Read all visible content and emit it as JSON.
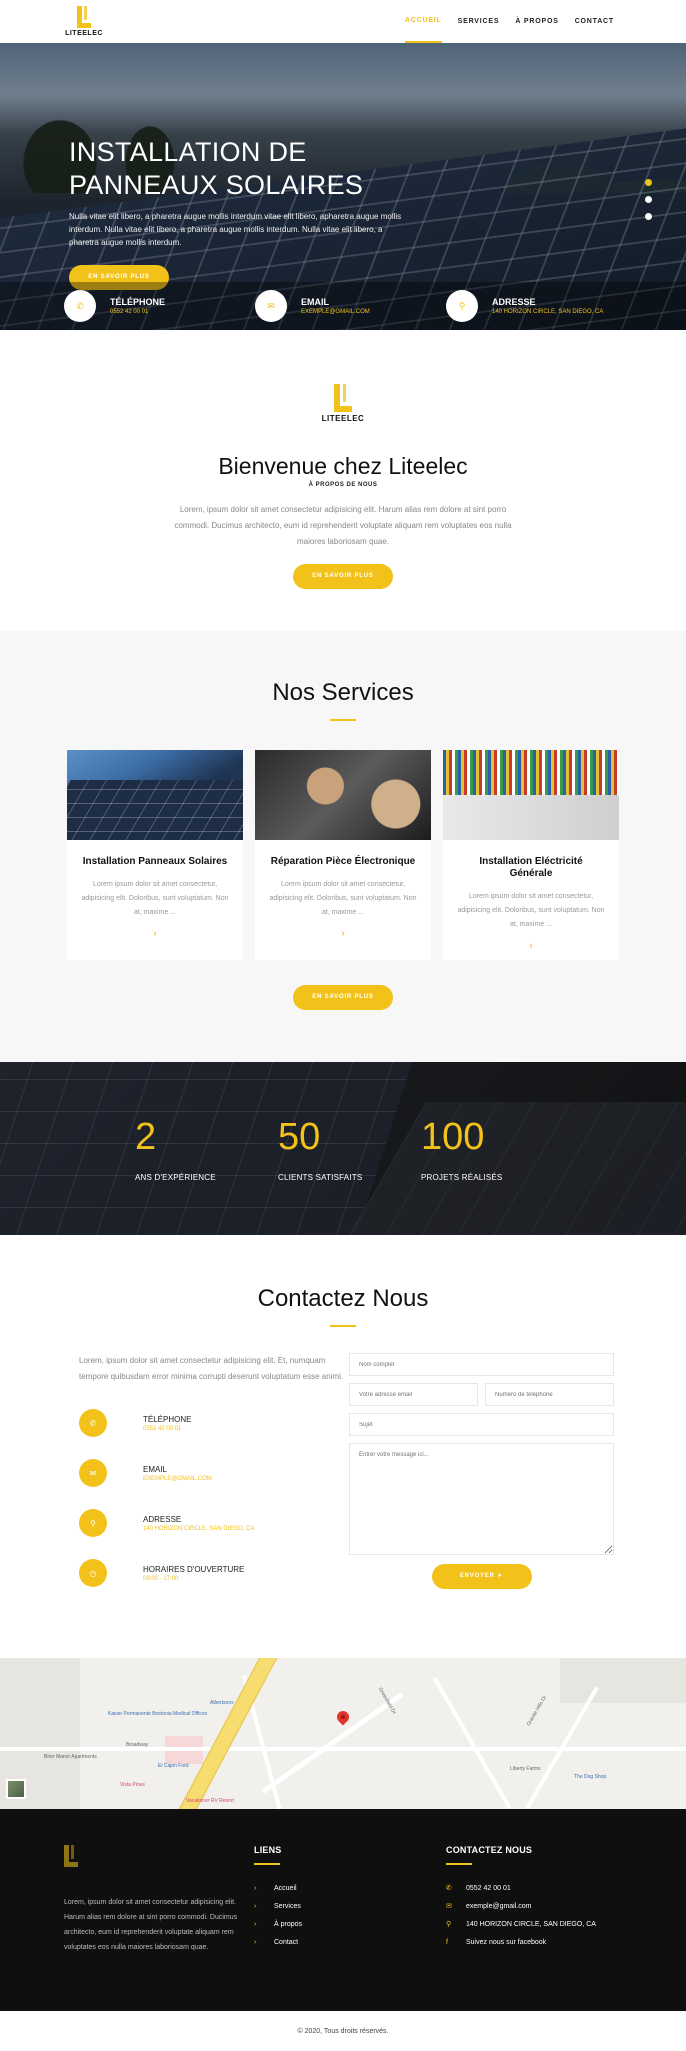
{
  "brand": {
    "name": "LITEELEC"
  },
  "nav": {
    "items": [
      {
        "label": "ACCUEIL",
        "active": true
      },
      {
        "label": "SERVICES"
      },
      {
        "label": "À PROPOS"
      },
      {
        "label": "CONTACT"
      }
    ]
  },
  "hero": {
    "title_line1": "INSTALLATION DE",
    "title_line2": "PANNEAUX SOLAIRES",
    "text": "Nulla vitae elit libero, a pharetra augue mollis interdum vitae elit libero, apharetra augue mollis interdum. Nulla vitae elit libero, a pharetra augue mollis interdum. Nulla vitae elit libero, a pharetra augue mollis interdum.",
    "button": "EN SAVOIR PLUS",
    "slides": 3,
    "active_slide": 1
  },
  "info_bar": [
    {
      "icon": "phone-icon",
      "label": "TÉLÉPHONE",
      "value": "0552 42 00 01"
    },
    {
      "icon": "email-icon",
      "label": "EMAIL",
      "value": "EXEMPLE@GMAIL.COM"
    },
    {
      "icon": "location-icon",
      "label": "ADRESSE",
      "value": "140 HORIZON CIRCLE, SAN DIEGO, CA"
    }
  ],
  "about": {
    "logo": "LITEELEC",
    "title": "Bienvenue chez Liteelec",
    "subtitle": "À PROPOS DE NOUS",
    "text": "Lorem, ipsum dolor sit amet consectetur adipisicing elit. Harum alias rem dolore at sint porro commodi. Ducimus architecto, eum id reprehenderit voluptate aliquam rem voluptates eos nulla maiores laboriosam quae.",
    "button": "EN SAVOIR PLUS"
  },
  "services": {
    "title": "Nos Services",
    "cards": [
      {
        "title": "Installation Panneaux Solaires",
        "text": "Lorem ipsum dolor sit amet consectetur, adipisicing elit. Doloribus, sunt voluptatum. Non at, maxime ...",
        "arrow": "›"
      },
      {
        "title": "Réparation Pièce Électronique",
        "text": "Lorem ipsum dolor sit amet consectetur, adipisicing elit. Doloribus, sunt voluptatum. Non at, maxime ...",
        "arrow": "›"
      },
      {
        "title": "Installation Eléctricité Générale",
        "text": "Lorem ipsum dolor sit amet consectetur, adipisicing elit. Doloribus, sunt voluptatum. Non at, maxime ...",
        "arrow": "›"
      }
    ],
    "button": "EN SAVOIR PLUS"
  },
  "stats": [
    {
      "value": "2",
      "label": "ANS D'EXPÉRIENCE"
    },
    {
      "value": "50",
      "label": "CLIENTS SATISFAITS"
    },
    {
      "value": "100",
      "label": "PROJETS RÉALISÉS"
    }
  ],
  "contact": {
    "title": "Contactez Nous",
    "text": "Lorem, ipsum dolor sit amet consectetur adipisicing elit. Et, numquam tempore quibusdam error minima corrupti deserunt voluptatum esse animi.",
    "items": [
      {
        "icon": "phone-icon",
        "label": "TÉLÉPHONE",
        "value": "0552 42 00 01"
      },
      {
        "icon": "email-icon",
        "label": "EMAIL",
        "value": "EXEMPLE@GMAIL.COM"
      },
      {
        "icon": "location-icon",
        "label": "ADRESSE",
        "value": "140 HORIZON CIRCLE, SAN DIEGO, CA"
      },
      {
        "icon": "clock-icon",
        "label": "HORAIRES D'OUVERTURE",
        "value": "09:00 - 17:00"
      }
    ],
    "form": {
      "name_placeholder": "Nom complet",
      "email_placeholder": "Votre adresse email",
      "phone_placeholder": "Numéro de téléphone",
      "subject_placeholder": "Sujet",
      "message_placeholder": "Entrer votre message ici...",
      "send_label": "ENVOYER ➤"
    }
  },
  "map": {
    "labels": [
      "Kaiser Permanente Bostonia Medical Offices",
      "Albertsons",
      "El Cajon Ford",
      "Vista Pines",
      "Vacationer RV Resort",
      "Liberty Farms",
      "The Dog Shop",
      "Broadway",
      "Brier Manor Apartments",
      "Greenfield Dr",
      "Granite Hills Dr"
    ]
  },
  "footer": {
    "about_text": "Lorem, ipsum dolor sit amet consectetur adipisicing elit. Harum alias rem dolore at sint porro commodi. Ducimus architecto, eum id reprehenderit voluptate aliquam rem voluptates eos nulla maiores laboriosam quae.",
    "links_title": "LIENS",
    "links": [
      "Accueil",
      "Services",
      "À propos",
      "Contact"
    ],
    "contact_title": "CONTACTEZ NOUS",
    "contact_items": [
      {
        "icon": "phone-icon",
        "text": "0552 42 00 01"
      },
      {
        "icon": "email-icon",
        "text": "exemple@gmail.com"
      },
      {
        "icon": "location-icon",
        "text": "140 HORIZON CIRCLE, SAN DIEGO, CA"
      },
      {
        "icon": "facebook-icon",
        "text": "Suivez nous sur facebook"
      }
    ],
    "copyright": "© 2020, Tous droits réservés."
  },
  "colors": {
    "accent": "#f3c21a",
    "footer_bg": "#0f0f0f",
    "section_bg": "#f7f7f7"
  }
}
